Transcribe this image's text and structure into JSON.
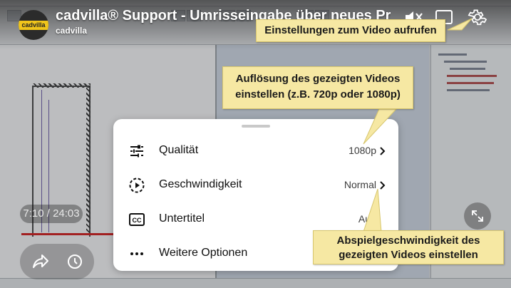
{
  "video": {
    "title": "cadvilla® Support - Umrisseingabe über neues Projekt",
    "channel": "cadvilla",
    "channel_logo_text": "cadvilla",
    "current_time": "7:10",
    "duration": "24:03",
    "time_display": "7:10 / 24:03"
  },
  "settings_sheet": {
    "items": [
      {
        "label": "Qualität",
        "value": "1080p",
        "icon": "sliders-icon"
      },
      {
        "label": "Geschwindigkeit",
        "value": "Normal",
        "icon": "playback-speed-icon"
      },
      {
        "label": "Untertitel",
        "value": "Aus",
        "icon": "captions-icon"
      },
      {
        "label": "Weitere Optionen",
        "value": "",
        "icon": "more-horizontal-icon"
      }
    ]
  },
  "callouts": {
    "settings": "Einstellungen zum Video aufrufen",
    "resolution": "Auflösung des gezeigten Videos einstellen (z.B. 720p oder 1080p)",
    "speed": "Abspielgeschwindigkeit des gezeigten Videos einstellen"
  },
  "colors": {
    "callout_bg": "#f6e8a3",
    "callout_border": "#d7c66e",
    "sheet_bg": "#ffffff",
    "logo_yellow": "#f0c51b"
  },
  "icons": {
    "top": [
      "mute-icon",
      "captions-toggle-icon",
      "gear-icon"
    ],
    "bottom": [
      "share-icon",
      "watch-later-icon",
      "fullscreen-icon"
    ]
  }
}
